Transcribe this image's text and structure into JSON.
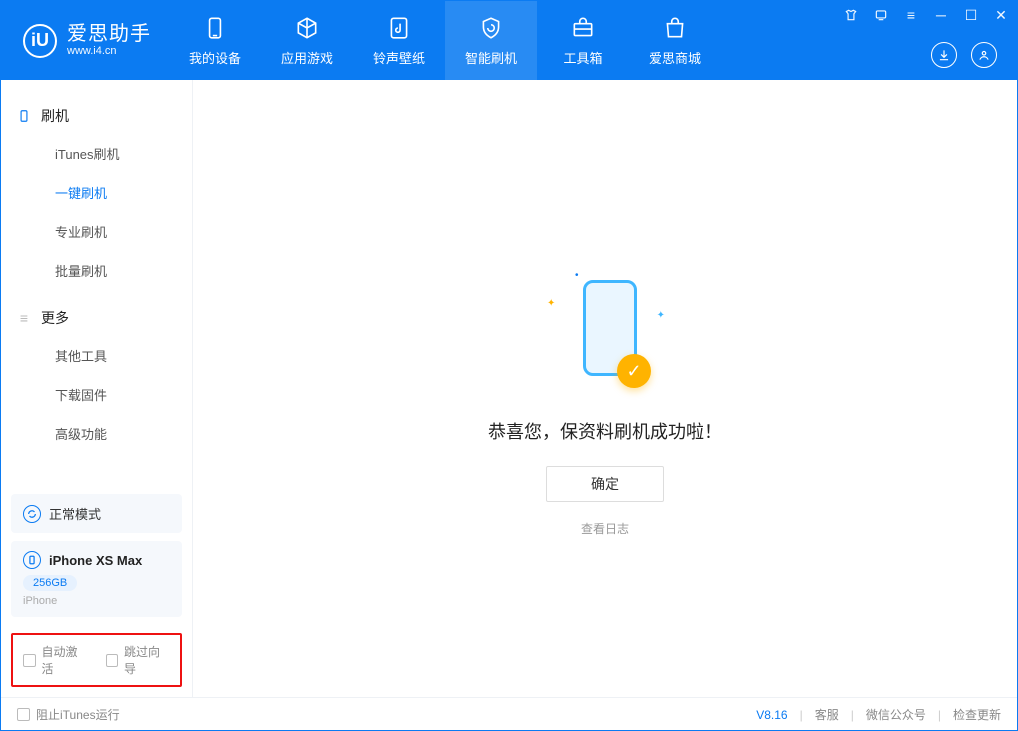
{
  "logo": {
    "title": "爱思助手",
    "subtitle": "www.i4.cn",
    "mark": "iU"
  },
  "nav": {
    "items": [
      {
        "label": "我的设备"
      },
      {
        "label": "应用游戏"
      },
      {
        "label": "铃声壁纸"
      },
      {
        "label": "智能刷机"
      },
      {
        "label": "工具箱"
      },
      {
        "label": "爱思商城"
      }
    ]
  },
  "sidebar": {
    "group1_title": "刷机",
    "group1_items": [
      {
        "label": "iTunes刷机"
      },
      {
        "label": "一键刷机"
      },
      {
        "label": "专业刷机"
      },
      {
        "label": "批量刷机"
      }
    ],
    "group2_title": "更多",
    "group2_items": [
      {
        "label": "其他工具"
      },
      {
        "label": "下载固件"
      },
      {
        "label": "高级功能"
      }
    ],
    "mode_card": {
      "label": "正常模式"
    },
    "device_card": {
      "name": "iPhone XS Max",
      "storage": "256GB",
      "type": "iPhone"
    },
    "checkboxes": {
      "auto_activate": "自动激活",
      "skip_guide": "跳过向导"
    }
  },
  "main": {
    "success_text": "恭喜您，保资料刷机成功啦！",
    "ok_button": "确定",
    "view_log": "查看日志"
  },
  "footer": {
    "block_itunes": "阻止iTunes运行",
    "version": "V8.16",
    "links": [
      "客服",
      "微信公众号",
      "检查更新"
    ]
  }
}
